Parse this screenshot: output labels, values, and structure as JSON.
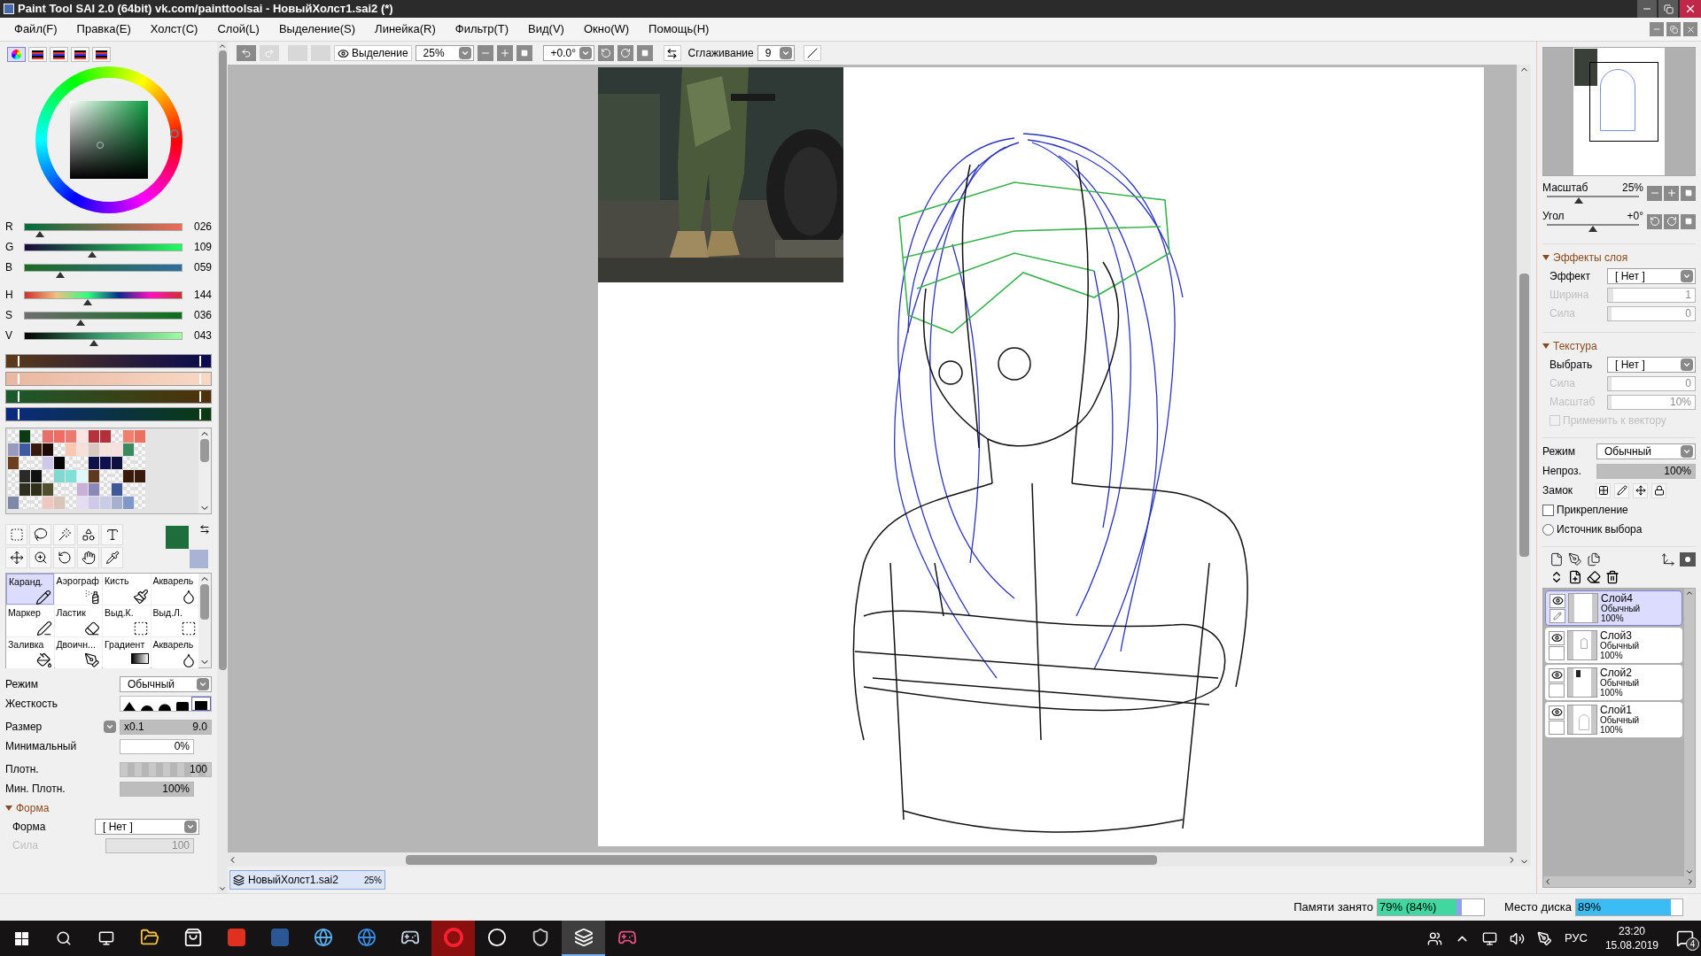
{
  "window": {
    "title": "Paint Tool SAI 2.0 (64bit) vk.com/painttoolsai - НовыйХолст1.sai2 (*)"
  },
  "menu": [
    "Файл(F)",
    "Правка(E)",
    "Холст(C)",
    "Слой(L)",
    "Выделение(S)",
    "Линейка(R)",
    "Фильтр(T)",
    "Вид(V)",
    "Окно(W)",
    "Помощь(H)"
  ],
  "color_modes": [
    {
      "selected": true
    },
    {
      "selected": false
    },
    {
      "selected": false
    },
    {
      "selected": false
    },
    {
      "selected": false
    }
  ],
  "sliders": [
    {
      "label": "R",
      "reading": "026",
      "level": 0.1
    },
    {
      "label": "G",
      "reading": "109",
      "level": 0.43
    },
    {
      "label": "B",
      "reading": "059",
      "level": 0.23
    },
    {
      "label": "H",
      "reading": "144",
      "level": 0.4
    },
    {
      "label": "S",
      "reading": "036",
      "level": 0.36
    },
    {
      "label": "V",
      "reading": "043",
      "level": 0.44
    }
  ],
  "palette": [
    {
      "kind": "empty"
    },
    {
      "kind": "swatch",
      "color": "#0c3a12"
    },
    {
      "kind": "empty"
    },
    {
      "kind": "swatch",
      "color": "#e8706a"
    },
    {
      "kind": "swatch",
      "color": "#ee6e66"
    },
    {
      "kind": "swatch",
      "color": "#ea7a72"
    },
    {
      "kind": "swatch",
      "color": "#fbe4e4"
    },
    {
      "kind": "swatch",
      "color": "#b5323a"
    },
    {
      "kind": "swatch",
      "color": "#b2303a"
    },
    {
      "kind": "empty"
    },
    {
      "kind": "swatch",
      "color": "#f08070"
    },
    {
      "kind": "swatch",
      "color": "#ec7060"
    },
    {
      "kind": "swatch",
      "color": "#9a9ac0"
    },
    {
      "kind": "swatch",
      "color": "#3e5aa0"
    },
    {
      "kind": "swatch",
      "color": "#3a1a0c"
    },
    {
      "kind": "swatch",
      "color": "#200a08"
    },
    {
      "kind": "empty"
    },
    {
      "kind": "swatch",
      "color": "#f8c8b0"
    },
    {
      "kind": "swatch",
      "color": "#f6e0d8"
    },
    {
      "kind": "swatch",
      "color": "#d8c8c0"
    },
    {
      "kind": "swatch",
      "color": "#f4e4dc"
    },
    {
      "kind": "swatch",
      "color": "#f8e0e0"
    },
    {
      "kind": "swatch",
      "color": "#3a8a60"
    },
    {
      "kind": "empty"
    },
    {
      "kind": "swatch",
      "color": "#6a4020"
    },
    {
      "kind": "empty"
    },
    {
      "kind": "empty"
    },
    {
      "kind": "swatch",
      "color": "#d0c8e8"
    },
    {
      "kind": "swatch",
      "color": "#050505"
    },
    {
      "kind": "empty"
    },
    {
      "kind": "empty"
    },
    {
      "kind": "swatch",
      "color": "#101048"
    },
    {
      "kind": "swatch",
      "color": "#101050"
    },
    {
      "kind": "swatch",
      "color": "#101040"
    },
    {
      "kind": "empty"
    },
    {
      "kind": "empty"
    },
    {
      "kind": "empty"
    },
    {
      "kind": "swatch",
      "color": "#2a2a28"
    },
    {
      "kind": "swatch",
      "color": "#101010"
    },
    {
      "kind": "empty"
    },
    {
      "kind": "swatch",
      "color": "#80d8d0"
    },
    {
      "kind": "swatch",
      "color": "#80e0d8"
    },
    {
      "kind": "swatch",
      "color": "#e0f8f8"
    },
    {
      "kind": "swatch",
      "color": "#603820"
    },
    {
      "kind": "empty"
    },
    {
      "kind": "empty"
    },
    {
      "kind": "swatch",
      "color": "#3a1808"
    },
    {
      "kind": "swatch",
      "color": "#3a1a0a"
    },
    {
      "kind": "empty"
    },
    {
      "kind": "swatch",
      "color": "#303020"
    },
    {
      "kind": "swatch",
      "color": "#303018"
    },
    {
      "kind": "swatch",
      "color": "#505030"
    },
    {
      "kind": "empty"
    },
    {
      "kind": "empty"
    },
    {
      "kind": "swatch",
      "color": "#c8b0d8"
    },
    {
      "kind": "swatch",
      "color": "#8a88b8"
    },
    {
      "kind": "empty"
    },
    {
      "kind": "swatch",
      "color": "#3e5898"
    },
    {
      "kind": "empty"
    },
    {
      "kind": "empty"
    },
    {
      "kind": "swatch",
      "color": "#8088a8"
    },
    {
      "kind": "empty"
    },
    {
      "kind": "empty"
    },
    {
      "kind": "swatch",
      "color": "#f0c8c0"
    },
    {
      "kind": "swatch",
      "color": "#d8c4b8"
    },
    {
      "kind": "empty"
    },
    {
      "kind": "swatch",
      "color": "#e4dcf4"
    },
    {
      "kind": "swatch",
      "color": "#d0c8e8"
    },
    {
      "kind": "swatch",
      "color": "#c8cce4"
    },
    {
      "kind": "swatch",
      "color": "#a8b0d0"
    },
    {
      "kind": "swatch",
      "color": "#8098c8"
    },
    {
      "kind": "empty"
    }
  ],
  "color_swatches": [
    {
      "kind": "secondary",
      "color": "#a9b3d3"
    },
    {
      "kind": "primary",
      "color": "#1e6e3c"
    }
  ],
  "brushes": [
    {
      "label": "Каранд.",
      "kind": "pencil",
      "selected": true
    },
    {
      "label": "Аэрограф",
      "kind": "airbrush",
      "selected": false
    },
    {
      "label": "Кисть",
      "kind": "brush",
      "selected": false
    },
    {
      "label": "Акварель",
      "kind": "watercolor",
      "selected": false
    },
    {
      "label": "Маркер",
      "kind": "marker",
      "selected": false
    },
    {
      "label": "Ластик",
      "kind": "eraser",
      "selected": false
    },
    {
      "label": "Выд.К.",
      "kind": "selpen",
      "selected": false
    },
    {
      "label": "Выд.Л.",
      "kind": "selerase",
      "selected": false
    },
    {
      "label": "Заливка",
      "kind": "bucket",
      "selected": false
    },
    {
      "label": "Двоичн...",
      "kind": "binary",
      "selected": false
    },
    {
      "label": "Градиент",
      "kind": "gradient",
      "selected": false
    },
    {
      "label": "Акварель",
      "kind": "watercolor",
      "selected": false
    }
  ],
  "brush": {
    "mode_label": "Режим",
    "mode": "Обычный",
    "hardness_label": "Жесткость",
    "hardness": [
      {
        "selected": false
      },
      {
        "selected": false
      },
      {
        "selected": false
      },
      {
        "selected": false
      },
      {
        "selected": true
      }
    ],
    "fields": [
      {
        "label": "Размер",
        "kind": "size",
        "prefix": "x0.1",
        "value": "9.0",
        "level": 1
      },
      {
        "label": "Минимальный",
        "kind": "input",
        "value": "0%"
      },
      {
        "label": "Плотн.",
        "kind": "density",
        "value": "100",
        "level": 1
      },
      {
        "label": "Мин. Плотн.",
        "kind": "bar",
        "value": "100%",
        "level": 1
      }
    ]
  },
  "shape": {
    "title": "Форма",
    "expanded": true,
    "label": "Форма",
    "value": "[ Нет ]",
    "strength_label": "Сила",
    "strength": "100",
    "level": 1,
    "disabled": true
  },
  "toolbar": {
    "selection_label": "Выделение",
    "zoom": "25%",
    "angle": "+0.0°",
    "smoothing_label": "Сглаживание",
    "smoothing": "9"
  },
  "document_tab": {
    "name": "НовыйХолст1.sai2",
    "zoom": "25%"
  },
  "navigator": [
    {
      "label": "Масштаб",
      "reading": "25%",
      "level": 0.35
    },
    {
      "label": "Угол",
      "reading": "+0°",
      "level": 0.5
    }
  ],
  "layer_effects": {
    "title": "Эффекты слоя",
    "expanded": true,
    "select_label": "Эффект",
    "select": "[ Нет ]",
    "fields": [
      {
        "label": "Ширина",
        "value": "1",
        "level": 0.06,
        "disabled": true
      },
      {
        "label": "Сила",
        "value": "0",
        "level": 0,
        "disabled": true
      }
    ]
  },
  "texture": {
    "title": "Текстура",
    "expanded": true,
    "select_label": "Выбрать",
    "select": "[ Нет ]",
    "fields": [
      {
        "label": "Сила",
        "value": "0",
        "level": 0,
        "disabled": true
      },
      {
        "label": "Масштаб",
        "value": "10%",
        "level": 0.01,
        "disabled": true
      }
    ],
    "apply": {
      "label": "Применить к вектору",
      "checked": false,
      "disabled": true
    }
  },
  "layer_props": {
    "mode_label": "Режим",
    "mode": "Обычный",
    "opacity_label": "Непроз.",
    "opacity": {
      "value": "100%",
      "level": 1
    },
    "lock_label": "Замок",
    "clip": {
      "label": "Прикрепление",
      "checked": false
    },
    "selection_source": {
      "label": "Источник выбора",
      "checked": false
    }
  },
  "layers": [
    {
      "name": "Слой4",
      "mode": "Обычный",
      "opacity": "100%",
      "visible": true,
      "selected": true,
      "kind": "blank"
    },
    {
      "name": "Слой3",
      "mode": "Обычный",
      "opacity": "100%",
      "visible": true,
      "selected": false,
      "kind": "hair"
    },
    {
      "name": "Слой2",
      "mode": "Обычный",
      "opacity": "100%",
      "visible": true,
      "selected": false
    },
    {
      "name": "Слой1",
      "mode": "Обычный",
      "opacity": "100%",
      "visible": true,
      "selected": false,
      "kind": "sketch"
    }
  ],
  "status": {
    "memory": {
      "label": "Памяти занято",
      "value": "79% (84%)",
      "level": 0.79
    },
    "disk": {
      "label": "Место диска",
      "value": "89%",
      "level": 0.89
    }
  },
  "taskbar": {
    "apps": [
      {
        "kind": "explorer",
        "selected": false
      },
      {
        "kind": "store",
        "selected": false
      },
      {
        "kind": "yandex",
        "selected": false
      },
      {
        "kind": "word",
        "selected": false
      },
      {
        "kind": "orb",
        "selected": false
      },
      {
        "kind": "edge",
        "selected": false
      },
      {
        "kind": "steam",
        "selected": false
      },
      {
        "kind": "opera",
        "selected": false
      },
      {
        "kind": "obs",
        "selected": false
      },
      {
        "kind": "shield",
        "selected": false
      },
      {
        "kind": "sai",
        "selected": true
      },
      {
        "kind": "game",
        "selected": false
      }
    ],
    "language": "РУС",
    "time": "23:20",
    "date": "15.08.2019",
    "notifications": "4"
  }
}
